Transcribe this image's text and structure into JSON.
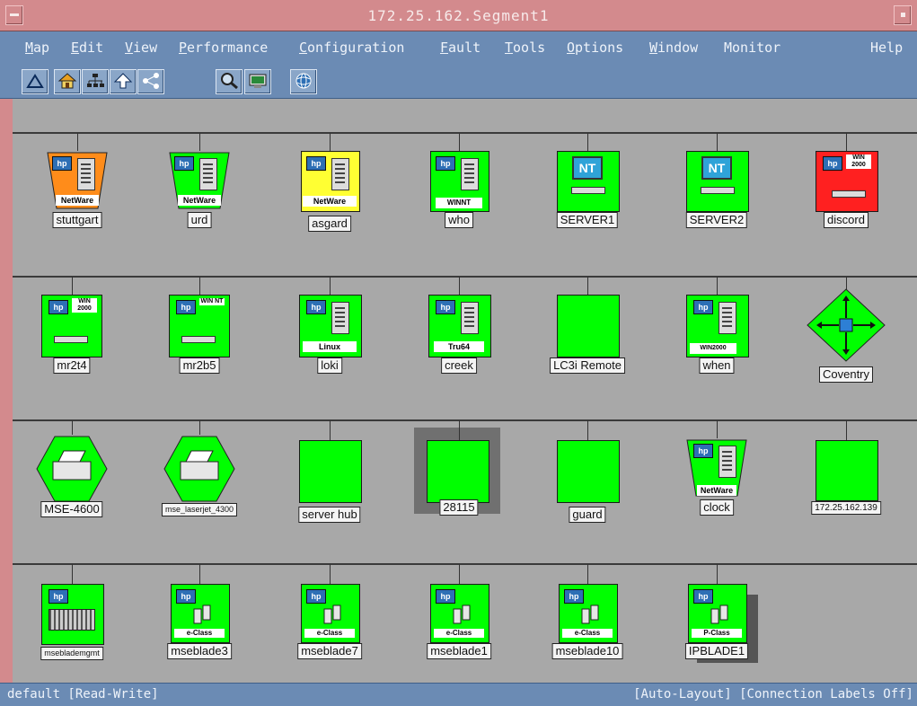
{
  "window": {
    "title": "172.25.162.Segment1"
  },
  "menu": [
    {
      "label": "Map",
      "accel": "M",
      "rest": "ap"
    },
    {
      "label": "Edit",
      "accel": "E",
      "rest": "dit"
    },
    {
      "label": "View",
      "accel": "V",
      "rest": "iew"
    },
    {
      "label": "Performance",
      "accel": "P",
      "rest": "erformance"
    },
    {
      "label": "Configuration",
      "accel": "C",
      "rest": "onfiguration"
    },
    {
      "label": "Fault",
      "accel": "F",
      "rest": "ault"
    },
    {
      "label": "Tools",
      "accel": "T",
      "rest": "ools"
    },
    {
      "label": "Options",
      "accel": "O",
      "rest": "ptions"
    },
    {
      "label": "Window",
      "accel": "W",
      "rest": "indow"
    },
    {
      "label": "Monitor",
      "accel": "",
      "rest": "Monitor"
    },
    {
      "label": "Help",
      "accel": "",
      "rest": "Help"
    }
  ],
  "toolbar": [
    "home-map-icon",
    "house-icon",
    "submap-icon",
    "parent-up-icon",
    "network-icon",
    "find-icon",
    "monitor-icon",
    "globe-icon"
  ],
  "nodes": {
    "stuttgart": {
      "label": "stuttgart",
      "tag": "NetWare",
      "status_color": "#ff8c1a"
    },
    "urd": {
      "label": "urd",
      "tag": "NetWare",
      "status_color": "#00ff00"
    },
    "asgard": {
      "label": "asgard",
      "tag": "NetWare",
      "status_color": "#ffff33"
    },
    "who": {
      "label": "who",
      "tag": "WINNT",
      "status_color": "#00ff00"
    },
    "server1": {
      "label": "SERVER1",
      "tag": "NT",
      "status_color": "#00ff00"
    },
    "server2": {
      "label": "SERVER2",
      "tag": "NT",
      "status_color": "#00ff00"
    },
    "discord": {
      "label": "discord",
      "tag": "WIN 2000",
      "status_color": "#ff2020"
    },
    "mr2t4": {
      "label": "mr2t4",
      "tag": "WIN 2000",
      "status_color": "#00ff00"
    },
    "mr2b5": {
      "label": "mr2b5",
      "tag": "WIN NT",
      "status_color": "#00ff00"
    },
    "loki": {
      "label": "loki",
      "tag": "Linux",
      "status_color": "#00ff00"
    },
    "creek": {
      "label": "creek",
      "tag": "Tru64",
      "status_color": "#00ff00"
    },
    "lc3": {
      "label": "LC3i Remote",
      "status_color": "#00ff00"
    },
    "when": {
      "label": "when",
      "tag": "WIN2000",
      "status_color": "#00ff00"
    },
    "coventry": {
      "label": "Coventry",
      "status_color": "#00ff00"
    },
    "mse4600": {
      "label": "MSE-4600",
      "status_color": "#00ff00"
    },
    "mselaserjet": {
      "label": "mse_laserjet_4300",
      "status_color": "#00ff00"
    },
    "serverhub": {
      "label": "server hub",
      "status_color": "#00ff00"
    },
    "n28115": {
      "label": "28115",
      "status_color": "#00ff00"
    },
    "guard": {
      "label": "guard",
      "status_color": "#00ff00"
    },
    "clock": {
      "label": "clock",
      "tag": "NetWare",
      "status_color": "#00ff00"
    },
    "ip139": {
      "label": "172.25.162.139",
      "status_color": "#00ff00"
    },
    "mseblademgmt": {
      "label": "mseblademgmt",
      "status_color": "#00ff00"
    },
    "mseblade3": {
      "label": "mseblade3",
      "tag": "e-Class",
      "status_color": "#00ff00"
    },
    "mseblade7": {
      "label": "mseblade7",
      "tag": "e-Class",
      "status_color": "#00ff00"
    },
    "mseblade1": {
      "label": "mseblade1",
      "tag": "e-Class",
      "status_color": "#00ff00"
    },
    "mseblade10": {
      "label": "mseblade10",
      "tag": "e-Class",
      "status_color": "#00ff00"
    },
    "ipblade1": {
      "label": "IPBLADE1",
      "tag": "P-Class",
      "status_color": "#00ff00"
    }
  },
  "status": {
    "left": "default [Read-Write]",
    "right": "[Auto-Layout] [Connection Labels Off]"
  }
}
